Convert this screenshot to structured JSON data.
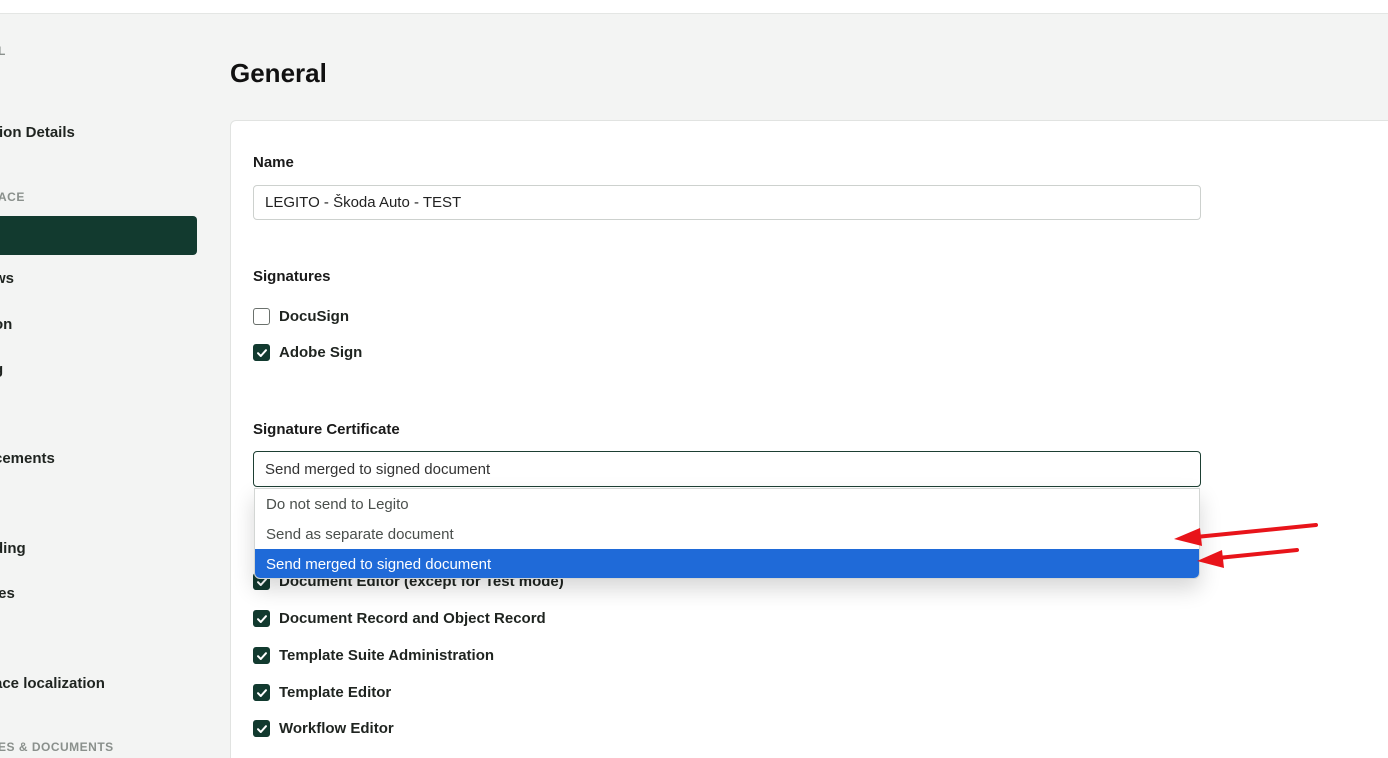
{
  "sidebar": {
    "sections": [
      {
        "label": "L"
      },
      {
        "label": "ACE"
      },
      {
        "label": "ES & DOCUMENTS"
      }
    ],
    "items": [
      {
        "label": "tion Details"
      },
      {
        "label": ""
      },
      {
        "label": "ws"
      },
      {
        "label": "on"
      },
      {
        "label": "g"
      },
      {
        "label": "cements"
      },
      {
        "label": "ding"
      },
      {
        "label": "ies"
      },
      {
        "label": "ace localization"
      }
    ]
  },
  "page": {
    "title": "General"
  },
  "form": {
    "name_label": "Name",
    "name_value": "LEGITO - Škoda Auto - TEST",
    "signatures_label": "Signatures",
    "signatures": [
      {
        "label": "DocuSign",
        "checked": false
      },
      {
        "label": "Adobe Sign",
        "checked": true
      }
    ],
    "certificate_label": "Signature Certificate",
    "certificate_selected": "Send merged to signed document",
    "certificate_options": [
      {
        "label": "Do not send to Legito"
      },
      {
        "label": "Send as separate document"
      },
      {
        "label": "Send merged to signed document",
        "selected": true
      }
    ],
    "permissions": [
      {
        "label": "Document Editor (except for Test mode)",
        "checked": true
      },
      {
        "label": "Document Record and Object Record",
        "checked": true
      },
      {
        "label": "Template Suite Administration",
        "checked": true
      },
      {
        "label": "Template Editor",
        "checked": true
      },
      {
        "label": "Workflow Editor",
        "checked": true
      }
    ]
  },
  "colors": {
    "accent": "#123a2f",
    "selected_option": "#1f6ad8",
    "annotation_arrow": "#e8141a"
  }
}
